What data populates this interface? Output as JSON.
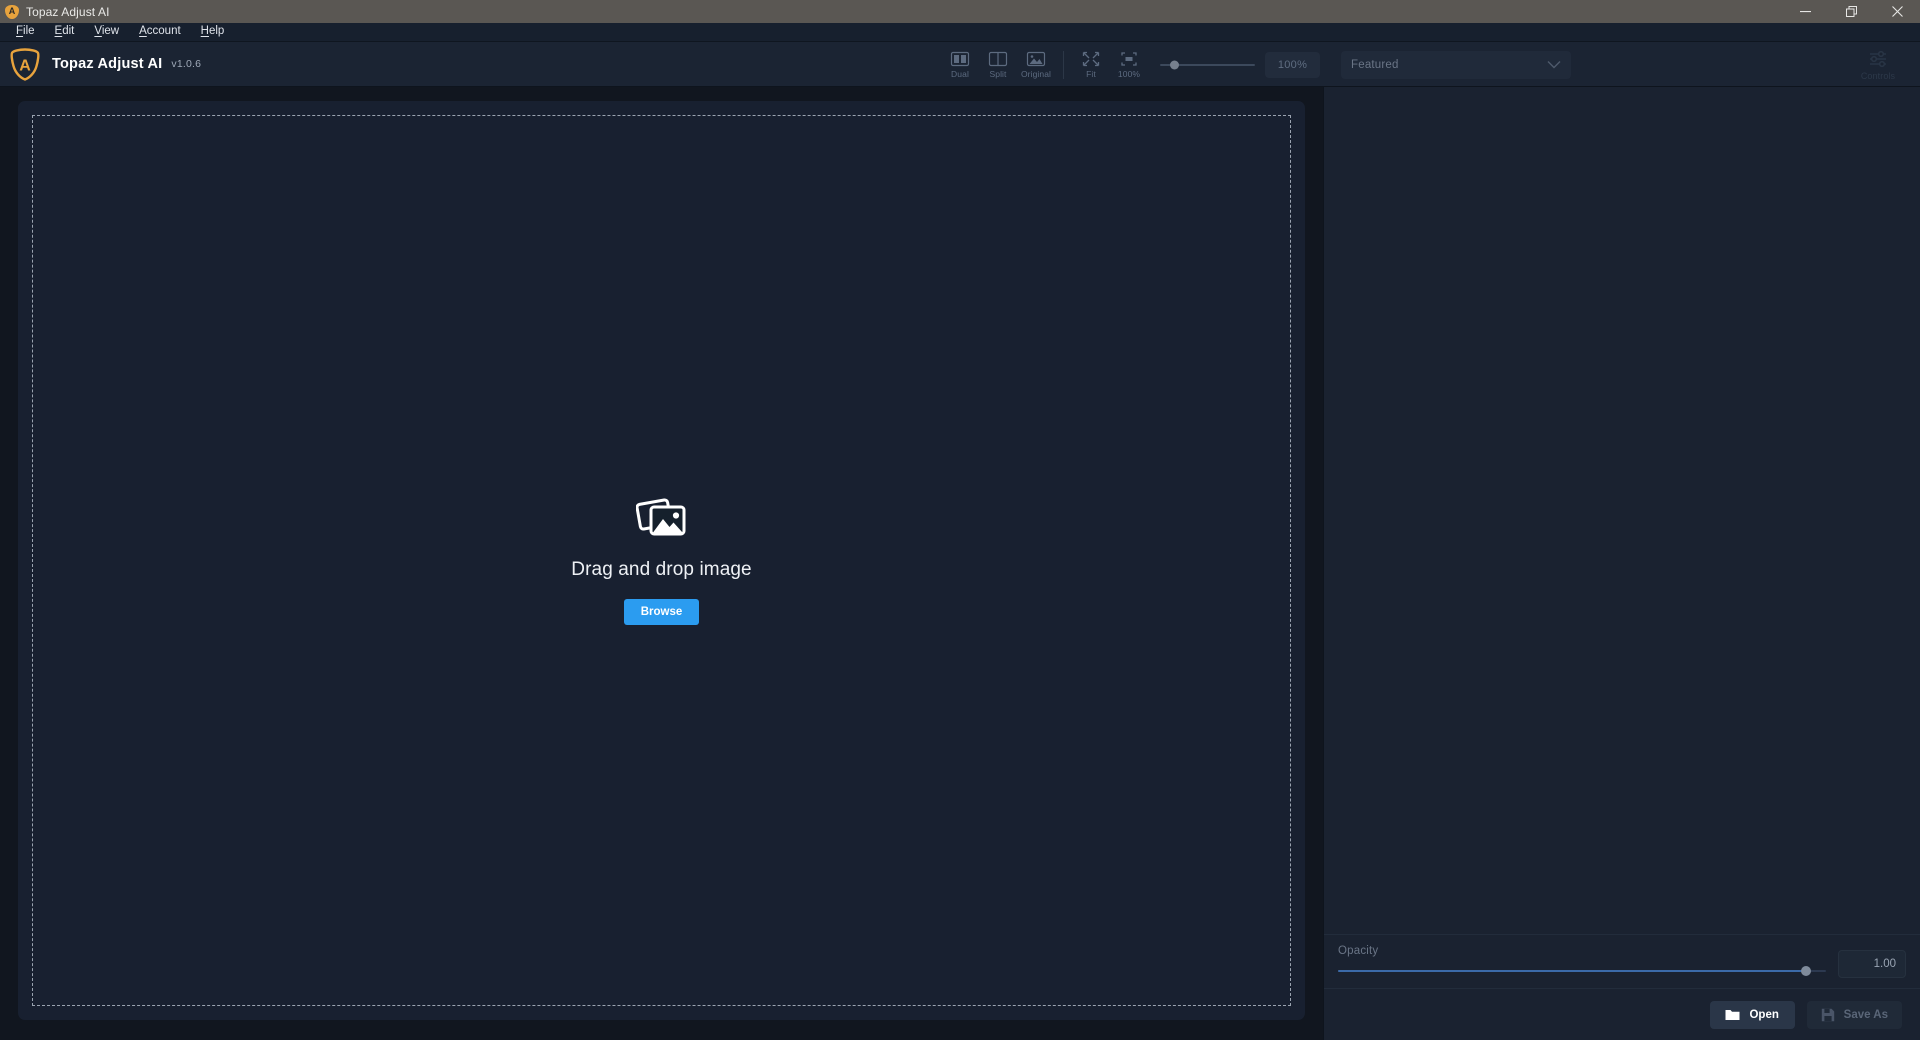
{
  "titlebar": {
    "title": "Topaz Adjust AI",
    "logo_icon": "topaz-shield-icon",
    "minimize_icon": "minimize-icon",
    "restore_icon": "restore-icon",
    "close_icon": "close-icon"
  },
  "menubar": {
    "items": [
      {
        "label": "File",
        "accel": "F"
      },
      {
        "label": "Edit",
        "accel": "E"
      },
      {
        "label": "View",
        "accel": "V"
      },
      {
        "label": "Account",
        "accel": "A"
      },
      {
        "label": "Help",
        "accel": "H"
      }
    ]
  },
  "appbar": {
    "brand_name": "Topaz Adjust AI",
    "version": "v1.0.6",
    "logo_icon": "topaz-shield-icon"
  },
  "toolbar": {
    "view_modes": [
      {
        "label": "Dual",
        "icon": "dual-view-icon"
      },
      {
        "label": "Split",
        "icon": "split-view-icon"
      },
      {
        "label": "Original",
        "icon": "original-image-icon"
      }
    ],
    "zoom_modes": [
      {
        "label": "Fit",
        "icon": "fit-screen-icon"
      },
      {
        "label": "100%",
        "icon": "actual-size-icon"
      }
    ],
    "zoom_slider_percent": 10,
    "zoom_readout": "100%"
  },
  "canvas": {
    "dropzone": {
      "icon": "photos-stack-icon",
      "message": "Drag and drop image",
      "browse_label": "Browse"
    }
  },
  "right_panel": {
    "preset_label": "Featured",
    "preset_chevron_icon": "chevron-down-icon",
    "controls_label": "Controls",
    "controls_icon": "sliders-icon",
    "controls_chevron_icon": "chevron-right-icon",
    "opacity": {
      "label": "Opacity",
      "value": "1.00",
      "percent": 96
    },
    "actions": {
      "open_label": "Open",
      "open_icon": "folder-icon",
      "save_label": "Save As",
      "save_icon": "floppy-disk-icon"
    }
  },
  "colors": {
    "accent_blue": "#2b9cf0",
    "brand_gold": "#e8a33d",
    "panel_bg": "#1a2230",
    "canvas_bg": "#11161f"
  }
}
